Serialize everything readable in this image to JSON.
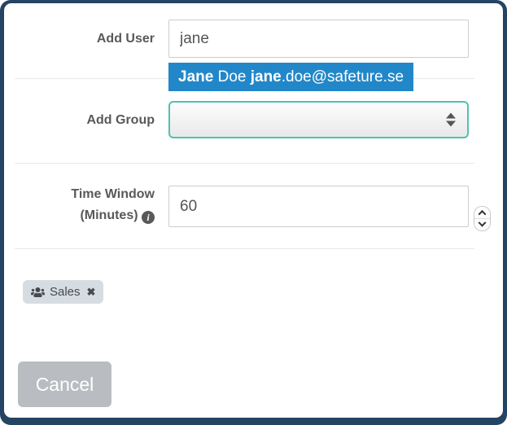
{
  "colors": {
    "frame": "#254363",
    "suggestion_bg": "#2287c9",
    "select_border": "#4ec3ae",
    "tag_bg": "#d5dde2",
    "cancel_bg": "#b9bdc1",
    "label_color": "#58595b"
  },
  "form": {
    "add_user": {
      "label": "Add User",
      "value": "jane"
    },
    "suggestion": {
      "name_match": "Jane",
      "name_rest": " Doe ",
      "email_match": "jane",
      "email_rest": ".doe@safeture.se"
    },
    "add_group": {
      "label": "Add Group",
      "value": ""
    },
    "time_window": {
      "label_line1": "Time Window",
      "label_line2": "(Minutes)",
      "value": "60"
    },
    "tag": {
      "label": "Sales"
    },
    "icons": {
      "info": "i",
      "close": "✖",
      "users": "users-icon"
    },
    "cancel_label": "Cancel"
  }
}
